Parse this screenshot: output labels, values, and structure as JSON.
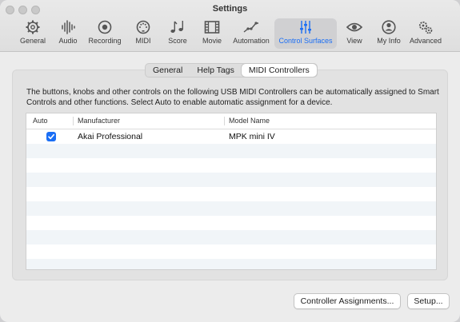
{
  "window": {
    "title": "Settings"
  },
  "toolbar": {
    "items": [
      {
        "label": "General",
        "icon": "gear-icon"
      },
      {
        "label": "Audio",
        "icon": "waveform-icon"
      },
      {
        "label": "Recording",
        "icon": "record-icon"
      },
      {
        "label": "MIDI",
        "icon": "midi-port-icon"
      },
      {
        "label": "Score",
        "icon": "music-notes-icon"
      },
      {
        "label": "Movie",
        "icon": "film-icon"
      },
      {
        "label": "Automation",
        "icon": "automation-curve-icon"
      },
      {
        "label": "Control Surfaces",
        "icon": "faders-icon",
        "selected": true
      },
      {
        "label": "View",
        "icon": "eye-icon"
      },
      {
        "label": "My Info",
        "icon": "person-icon"
      },
      {
        "label": "Advanced",
        "icon": "gears-icon"
      }
    ]
  },
  "tabs": [
    {
      "label": "General"
    },
    {
      "label": "Help Tags"
    },
    {
      "label": "MIDI Controllers",
      "selected": true
    }
  ],
  "description": "The buttons, knobs and other controls on the following USB MIDI Controllers can be automatically assigned to Smart Controls and other functions. Select Auto to enable automatic assignment for a device.",
  "table": {
    "columns": [
      "Auto",
      "Manufacturer",
      "Model Name"
    ],
    "rows": [
      {
        "auto": true,
        "manufacturer": "Akai Professional",
        "model": "MPK mini IV"
      }
    ]
  },
  "buttons": {
    "controller_assignments": "Controller Assignments...",
    "setup": "Setup..."
  },
  "colors": {
    "accent": "#1a6ef5"
  }
}
